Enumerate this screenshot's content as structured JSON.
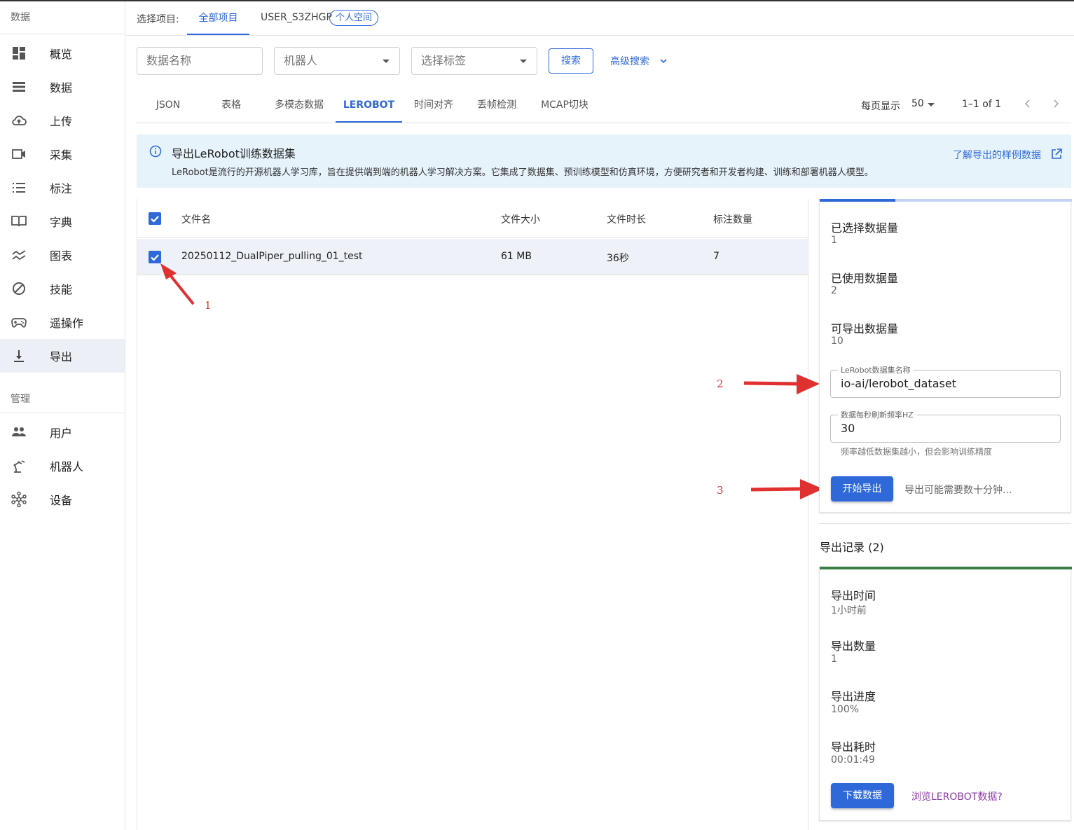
{
  "sidebar": {
    "section_data": "数据",
    "items": [
      {
        "label": "概览",
        "icon": "dashboard-icon"
      },
      {
        "label": "数据",
        "icon": "list-icon"
      },
      {
        "label": "上传",
        "icon": "cloud-upload-icon"
      },
      {
        "label": "采集",
        "icon": "video-camera-icon"
      },
      {
        "label": "标注",
        "icon": "list-numbered-icon"
      },
      {
        "label": "字典",
        "icon": "book-icon"
      },
      {
        "label": "图表",
        "icon": "chart-line-icon"
      },
      {
        "label": "技能",
        "icon": "skill-icon"
      },
      {
        "label": "遥操作",
        "icon": "gamepad-icon"
      },
      {
        "label": "导出",
        "icon": "download-icon",
        "active": true
      }
    ],
    "section_manage": "管理",
    "manage_items": [
      {
        "label": "用户",
        "icon": "users-icon"
      },
      {
        "label": "机器人",
        "icon": "robot-arm-icon"
      },
      {
        "label": "设备",
        "icon": "device-hub-icon"
      }
    ]
  },
  "project_bar": {
    "label": "选择项目:",
    "tab_all": "全部项目",
    "user": "USER_S3ZHGP",
    "badge": "个人空间"
  },
  "filters": {
    "name_placeholder": "数据名称",
    "robot_select": "机器人",
    "tag_select": "选择标签",
    "search_button": "搜索",
    "advanced_search": "高级搜索"
  },
  "tabs": [
    {
      "label": "JSON"
    },
    {
      "label": "表格"
    },
    {
      "label": "多模态数据"
    },
    {
      "label": "LEROBOT",
      "active": true
    },
    {
      "label": "时间对齐"
    },
    {
      "label": "丢帧检测"
    },
    {
      "label": "MCAP切块"
    }
  ],
  "pagination": {
    "per_page_label": "每页显示",
    "per_page_value": "50",
    "range": "1–1 of 1"
  },
  "banner": {
    "title": "导出LeRobot训练数据集",
    "text": "LeRobot是流行的开源机器人学习库，旨在提供端到端的机器人学习解决方案。它集成了数据集、预训练模型和仿真环境，方便研究者和开发者构建、训练和部署机器人模型。",
    "link": "了解导出的样例数据"
  },
  "table": {
    "headers": [
      "文件名",
      "文件大小",
      "文件时长",
      "标注数量"
    ],
    "rows": [
      {
        "name": "20250112_DualPiper_pulling_01_test",
        "size": "61 MB",
        "duration": "36秒",
        "labels": "7"
      }
    ]
  },
  "annotations": [
    "1",
    "2",
    "3"
  ],
  "export_panel": {
    "selected_label": "已选择数据量",
    "selected_value": "1",
    "used_label": "已使用数据量",
    "used_value": "2",
    "exportable_label": "可导出数据量",
    "exportable_value": "10",
    "dataset_name_label": "LeRobot数据集名称",
    "dataset_name_value": "io-ai/lerobot_dataset",
    "fps_label": "数据每秒刷新频率HZ",
    "fps_value": "30",
    "fps_hint": "频率越低数据集越小，但会影响训练精度",
    "start_button": "开始导出",
    "note": "导出可能需要数十分钟..."
  },
  "records": {
    "title": "导出记录 (2)",
    "time_label": "导出时间",
    "time_value": "1小时前",
    "count_label": "导出数量",
    "count_value": "1",
    "progress_label": "导出进度",
    "progress_value": "100%",
    "duration_label": "导出耗时",
    "duration_value": "00:01:49",
    "download_button": "下载数据",
    "browse_link": "浏览LEROBOT数据?"
  },
  "colors": {
    "primary": "#2f69d9",
    "banner_bg": "#e6f3fb",
    "success_bar": "#3a7d44",
    "annotation": "#dd3333",
    "link_purple": "#8e3aa8"
  }
}
